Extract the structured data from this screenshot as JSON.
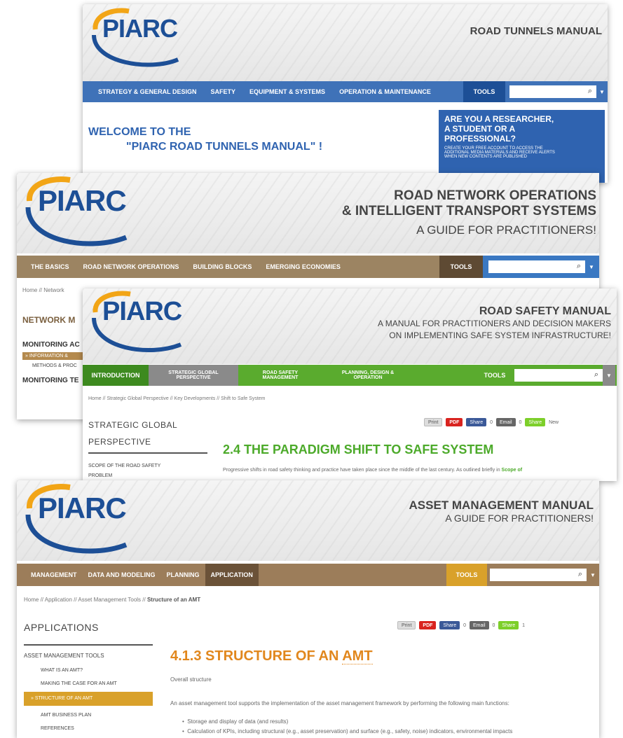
{
  "tunnels": {
    "logo": "PIARC",
    "title": "ROAD TUNNELS MANUAL",
    "nav": [
      "STRATEGY & GENERAL DESIGN",
      "SAFETY",
      "EQUIPMENT & SYSTEMS",
      "OPERATION & MAINTENANCE"
    ],
    "tools": "TOOLS",
    "welcome_line1": "WELCOME TO THE",
    "welcome_line2": "\"PIARC ROAD TUNNELS MANUAL\" !",
    "promo_line1": "ARE YOU A RESEARCHER,",
    "promo_line2": "A STUDENT OR A",
    "promo_line3": "PROFESSIONAL?",
    "promo_small1": "CREATE YOUR FREE ACCOUNT TO ACCESS THE",
    "promo_small2": "ADDITIONAL MEDIA MATERIALS AND RECEIVE ALERTS",
    "promo_small3": "WHEN NEW CONTENTS ARE PUBLISHED",
    "colors": {
      "nav": "#3f72b8",
      "tools": "#1d4f96",
      "promo": "#2f63b0"
    }
  },
  "rno": {
    "logo": "PIARC",
    "title_line1": "ROAD NETWORK OPERATIONS",
    "title_line2": "& INTELLIGENT TRANSPORT SYSTEMS",
    "subtitle": "A GUIDE FOR PRACTITIONERS!",
    "nav": [
      "THE BASICS",
      "ROAD NETWORK OPERATIONS",
      "BUILDING BLOCKS",
      "EMERGING ECONOMIES"
    ],
    "tools": "TOOLS",
    "breadcrumb": "Home // Network",
    "side_heading": "NETWORK M",
    "side_item1": "MONITORING AC",
    "side_item2": "» INFORMATION &",
    "side_item3": "METHODS & PROC",
    "side_item4": "MONITORING TE",
    "colors": {
      "nav": "#9c8462",
      "tools": "#5e4a33",
      "search_btn": "#3a78c2"
    }
  },
  "safety": {
    "logo": "PIARC",
    "title": "ROAD SAFETY MANUAL",
    "subtitle_line1": "A MANUAL FOR PRACTITIONERS AND DECISION MAKERS",
    "subtitle_line2": "ON IMPLEMENTING SAFE SYSTEM INFRASTRUCTURE!",
    "nav": [
      "INTRODUCTION",
      "STRATEGIC GLOBAL PERSPECTIVE",
      "ROAD SAFETY MANAGEMENT",
      "PLANNING, DESIGN & OPERATION"
    ],
    "tools": "TOOLS",
    "breadcrumb": "Home // Strategic Global Perspective // Key Developments // Shift to Safe System",
    "side_heading1": "STRATEGIC GLOBAL",
    "side_heading2": "PERSPECTIVE",
    "side_item1": "SCOPE OF THE ROAD SAFETY",
    "side_item2": "PROBLEM",
    "share": {
      "print": "Print",
      "pdf": "PDF",
      "fb": "Share",
      "fb_count": "0",
      "email": "Email",
      "email_count": "0",
      "share": "Share",
      "new": "New"
    },
    "heading": "2.4 THE PARADIGM SHIFT TO SAFE SYSTEM",
    "intro": "Progressive shifts in road safety thinking and practice have taken place since the middle of the last century. As outlined briefly in",
    "intro_link": "Scope of",
    "colors": {
      "nav": "#5aab2e",
      "nav_dark": "#3d8a1f",
      "nav_gray": "#8a8a8a",
      "heading": "#4caa2a"
    }
  },
  "asset": {
    "logo": "PIARC",
    "title": "ASSET MANAGEMENT MANUAL",
    "subtitle": "A GUIDE FOR PRACTITIONERS!",
    "nav": [
      "MANAGEMENT",
      "DATA AND MODELING",
      "PLANNING",
      "APPLICATION"
    ],
    "tools": "TOOLS",
    "breadcrumb_prefix": "Home // Application // Asset Management Tools // ",
    "breadcrumb_current": "Structure of an AMT",
    "side_heading": "APPLICATIONS",
    "side_section": "ASSET MANAGEMENT TOOLS",
    "side_items": [
      "WHAT IS AN AMT?",
      "MAKING THE CASE FOR AN AMT",
      "» STRUCTURE OF AN AMT",
      "AMT BUSINESS PLAN",
      "REFERENCES"
    ],
    "share": {
      "print": "Print",
      "pdf": "PDF",
      "fb": "Share",
      "fb_count": "0",
      "email": "Email",
      "email_count": "0",
      "share": "Share",
      "share_count": "1"
    },
    "heading_main": "4.1.3 STRUCTURE OF AN ",
    "heading_link": "AMT",
    "subheading": "Overall structure",
    "paragraph": "An asset management tool supports the implementation of the asset management framework by performing the following main functions:",
    "bullet1": "Storage and display of data (and results)",
    "bullet2": "Calculation of KPIs, including structural (e.g., asset preservation) and surface (e.g., safety, noise) indicators, environmental impacts",
    "colors": {
      "nav": "#9c7d5a",
      "nav_active": "#6b5238",
      "tools": "#d9a12a",
      "heading": "#e1871d",
      "active_item": "#d9a12a"
    }
  }
}
